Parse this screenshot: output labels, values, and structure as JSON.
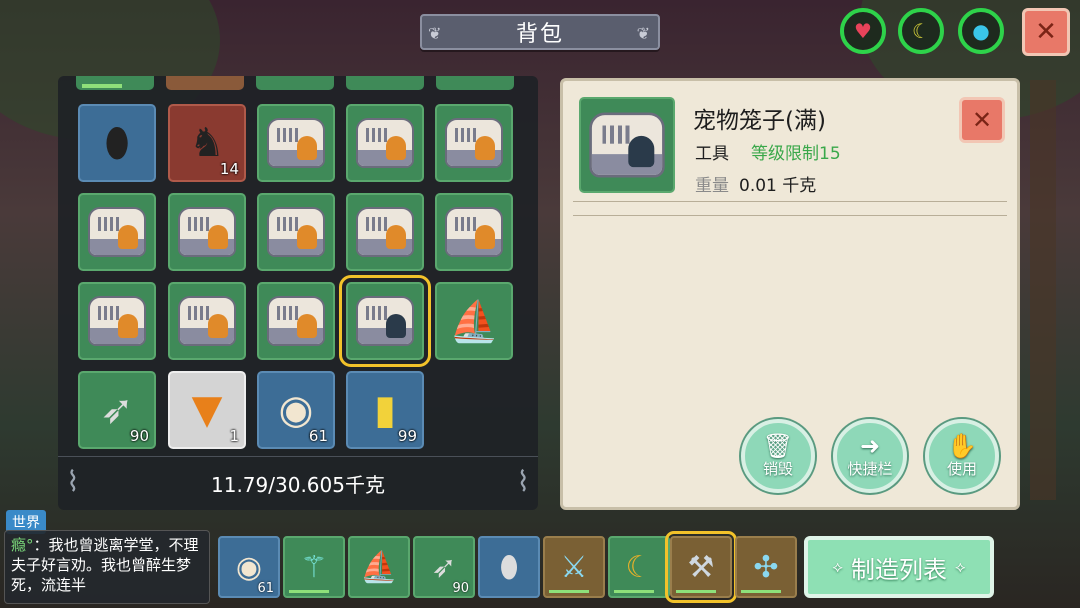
{
  "title": "背包",
  "stats": {
    "heart_icon": "heart-icon",
    "food_icon": "banana-icon",
    "water_icon": "water-drop-icon",
    "ring_color": "#2ed34a"
  },
  "close_glyph": "✕",
  "inventory": {
    "rows": [
      [
        {
          "item": "blue-stone-disc",
          "count": ""
        },
        {
          "item": "red-saddle",
          "count": "14"
        },
        {
          "item": "pet-cage",
          "count": ""
        },
        {
          "item": "pet-cage",
          "count": ""
        },
        {
          "item": "pet-cage",
          "count": ""
        }
      ],
      [
        {
          "item": "pet-cage",
          "count": ""
        },
        {
          "item": "pet-cage",
          "count": ""
        },
        {
          "item": "pet-cage",
          "count": ""
        },
        {
          "item": "pet-cage",
          "count": ""
        },
        {
          "item": "pet-cage",
          "count": ""
        }
      ],
      [
        {
          "item": "pet-cage",
          "count": ""
        },
        {
          "item": "pet-cage",
          "count": ""
        },
        {
          "item": "pet-cage",
          "count": ""
        },
        {
          "item": "pet-cage-full",
          "count": ""
        },
        {
          "item": "wooden-canoe",
          "count": ""
        }
      ],
      [
        {
          "item": "arrows",
          "count": "90"
        },
        {
          "item": "carrots",
          "count": "1"
        },
        {
          "item": "steamed-buns",
          "count": "61"
        },
        {
          "item": "pet-food-bag",
          "count": "99"
        }
      ]
    ],
    "weight": "11.79/30.605千克"
  },
  "detail": {
    "name": "宠物笼子(满)",
    "type": "工具",
    "level": "等级限制15",
    "weight_label": "重量",
    "weight_value": "0.01 千克",
    "actions": [
      {
        "label": "销毁",
        "icon": "trash-icon"
      },
      {
        "label": "快捷栏",
        "icon": "arrow-left-icon"
      },
      {
        "label": "使用",
        "icon": "hand-icon"
      }
    ]
  },
  "chat": {
    "channel": "世界",
    "user": "瘾°",
    "message": "：我也曾逃离学堂，不理夫子好言劝。我也曾醉生梦死，流连半"
  },
  "hotbar": [
    {
      "item": "steamed-buns",
      "count": "61"
    },
    {
      "item": "crystal-staff",
      "count": ""
    },
    {
      "item": "wooden-canoe",
      "count": ""
    },
    {
      "item": "arrows",
      "count": "90"
    },
    {
      "item": "blue-stone-disc",
      "count": ""
    },
    {
      "item": "crystal-sword",
      "count": ""
    },
    {
      "item": "banana-boat",
      "count": ""
    },
    {
      "item": "pickaxe",
      "count": ""
    },
    {
      "item": "crystal-crossbow",
      "count": ""
    }
  ],
  "craft_label": "制造列表"
}
